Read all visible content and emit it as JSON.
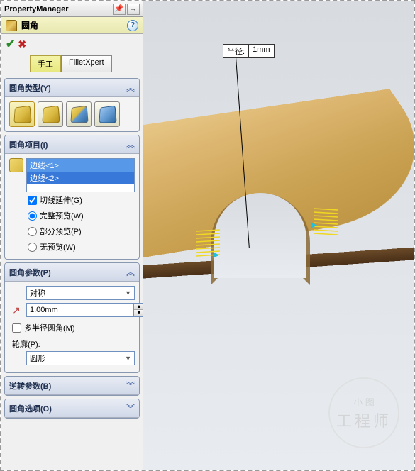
{
  "header": {
    "title": "PropertyManager"
  },
  "feature": {
    "name": "圆角",
    "help": "?"
  },
  "modes": {
    "manual": "手工",
    "xpert": "FilletXpert"
  },
  "sections": {
    "type": {
      "title": "圆角类型(Y)"
    },
    "items": {
      "title": "圆角项目(I)",
      "list": [
        "边线<1>",
        "边线<2>"
      ],
      "tangent": "切线延伸(G)",
      "fullPreview": "完整预览(W)",
      "partialPreview": "部分预览(P)",
      "noPreview": "无预览(W)"
    },
    "params": {
      "title": "圆角参数(P)",
      "symmetry": "对称",
      "radius": "1.00mm",
      "multiRadius": "多半径圆角(M)",
      "profileLabel": "轮廓(P):",
      "profile": "圆形"
    },
    "reverse": {
      "title": "逆转参数(B)"
    },
    "options": {
      "title": "圆角选项(O)"
    }
  },
  "callout": {
    "label": "半径:",
    "value": "1mm"
  },
  "watermark": {
    "top": "小 图",
    "main": "工程师"
  }
}
